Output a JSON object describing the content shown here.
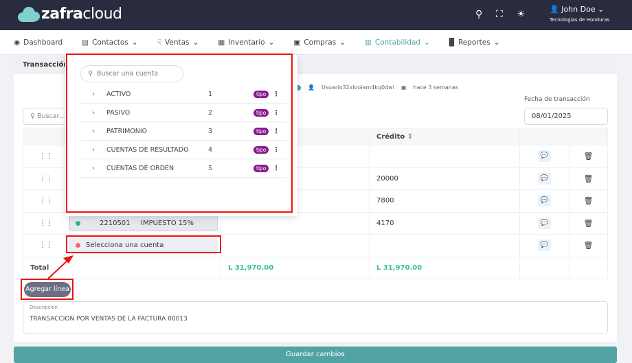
{
  "header": {
    "brand_bold": "zafra",
    "brand_light": "cloud",
    "user_name": "John Doe",
    "company": "Tecnologias de Honduras",
    "icons": [
      "search-icon",
      "fullscreen-icon",
      "theme-icon",
      "user-icon"
    ]
  },
  "nav": [
    {
      "label": "Dashboard"
    },
    {
      "label": "Contactos"
    },
    {
      "label": "Ventas"
    },
    {
      "label": "Inventario"
    },
    {
      "label": "Compras"
    },
    {
      "label": "Contabilidad"
    },
    {
      "label": "Reportes"
    }
  ],
  "card": {
    "title": "Transacción",
    "user": "Usuario32xlooiam4kq0dwl",
    "time": "hace 3 semanas",
    "search_placeholder": "Buscar...",
    "date_label": "Fecha de transacción",
    "date_value": "08/01/2025"
  },
  "table": {
    "credit_header": "Crédito",
    "rows": [
      {
        "account_code": "",
        "account_name": "",
        "credit": ""
      },
      {
        "account_code": "",
        "account_name": "",
        "credit": "20000"
      },
      {
        "account_code": "",
        "account_name": "",
        "credit": "7800"
      },
      {
        "account_code": "2210501",
        "account_name": "IMPUESTO 15%",
        "credit": "4170"
      },
      {
        "account_placeholder": "Selecciona una cuenta",
        "credit": ""
      }
    ],
    "total_label": "Total",
    "total_debit": "L 31,970.00",
    "total_credit": "L 31,970.00"
  },
  "add_line": "Agregar línea",
  "description": {
    "label": "Descripción",
    "value": "TRANSACCION POR VENTAS DE LA FACTURA  00013"
  },
  "save": "Guardar cambios",
  "dropdown": {
    "search_placeholder": "Buscar una cuenta",
    "badge": "tipo",
    "items": [
      {
        "name": "ACTIVO",
        "num": "1"
      },
      {
        "name": "PASIVO",
        "num": "2"
      },
      {
        "name": "PATRIMONIO",
        "num": "3"
      },
      {
        "name": "CUENTAS DE RESULTADO",
        "num": "4"
      },
      {
        "name": "CUENTAS DE ORDEN",
        "num": "5"
      }
    ]
  }
}
